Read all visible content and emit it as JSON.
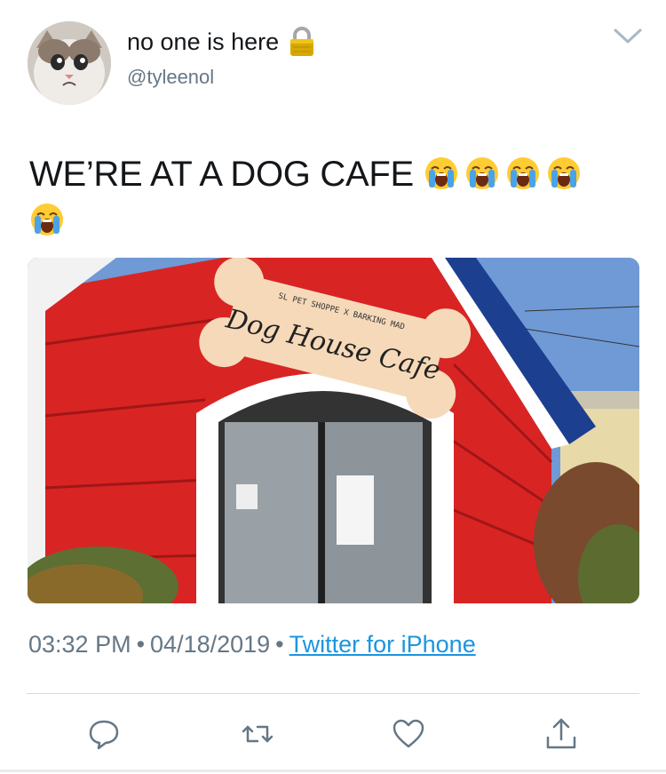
{
  "author": {
    "name": "no one is here",
    "handle": "@tyleenol",
    "avatar_icon": "crying-cat-avatar",
    "protected_icon": "lock-icon"
  },
  "tweet": {
    "text": "WE’RE AT A DOG CAFE",
    "emoji": [
      "loudly-crying-face",
      "loudly-crying-face",
      "loudly-crying-face",
      "loudly-crying-face",
      "loudly-crying-face"
    ],
    "photo": {
      "sign_top": "SL PET SHOPPE X BARKING MAD",
      "sign_main": "Dog House Cafe"
    }
  },
  "meta": {
    "time": "03:32 PM",
    "date": "04/18/2019",
    "separator": "•",
    "source": "Twitter for iPhone"
  },
  "actions": [
    "reply-icon",
    "retweet-icon",
    "like-icon",
    "share-icon"
  ],
  "colors": {
    "link": "#1b95e0",
    "secondary_text": "#657786",
    "primary_text": "#14171a"
  }
}
